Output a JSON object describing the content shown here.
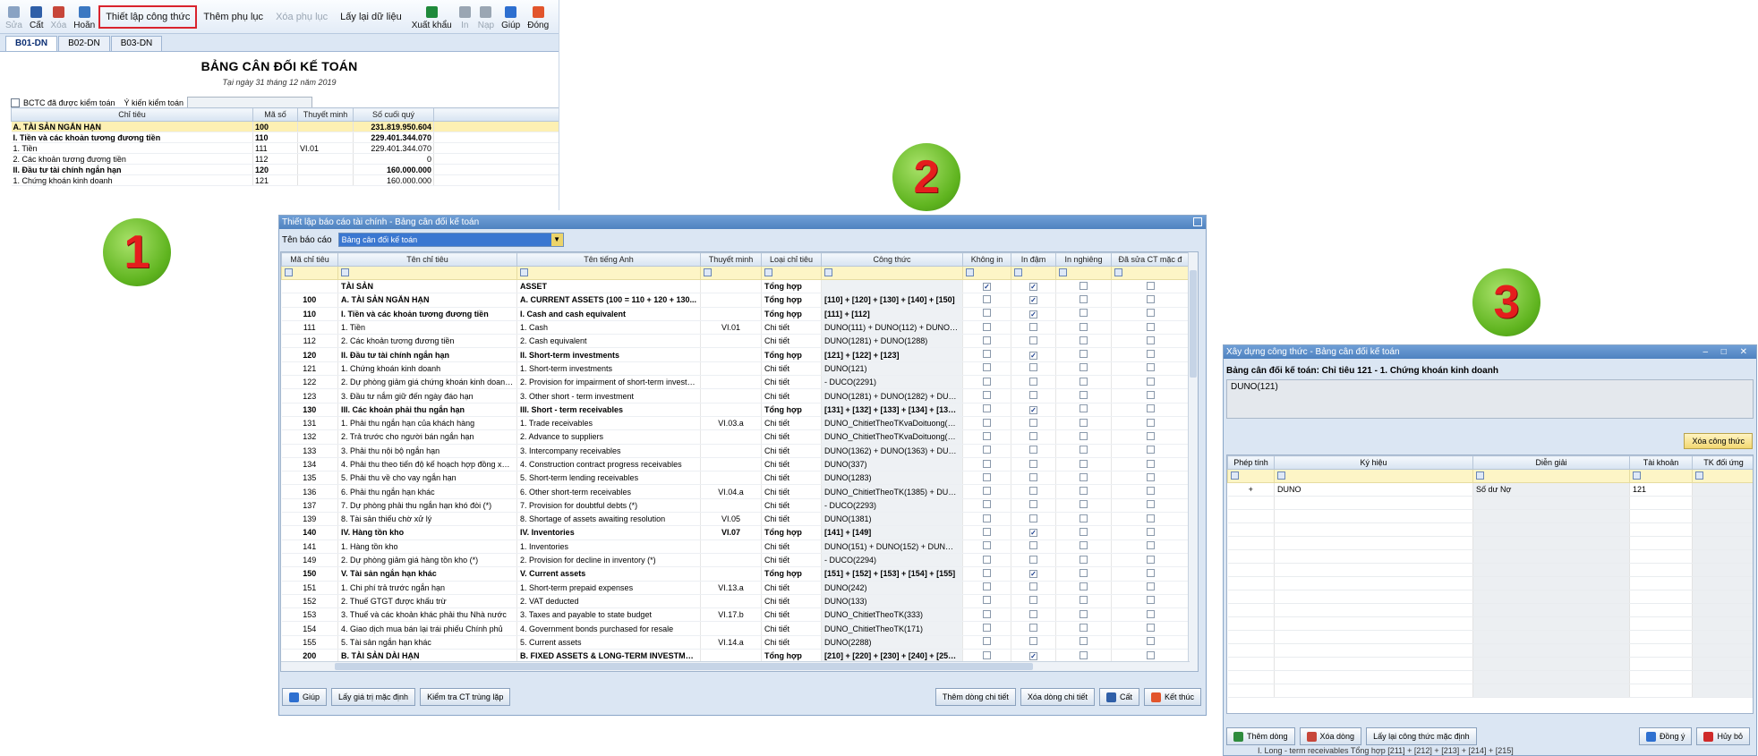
{
  "panel1": {
    "toolbar": [
      {
        "label": "Sửa",
        "icon": "edit-icon",
        "disabled": true
      },
      {
        "label": "Cất",
        "icon": "save-icon",
        "disabled": false
      },
      {
        "label": "Xóa",
        "icon": "delete-icon",
        "disabled": true
      },
      {
        "label": "Hoãn",
        "icon": "undo-icon",
        "disabled": false
      },
      {
        "label": "Thiết lập công thức",
        "text": true,
        "highlight": true
      },
      {
        "label": "Thêm phụ lục",
        "text": true
      },
      {
        "label": "Xóa phụ lục",
        "text": true,
        "disabled": true
      },
      {
        "label": "Lấy lại dữ liệu",
        "text": true
      },
      {
        "label": "Xuất khẩu",
        "icon": "excel-icon",
        "disabled": false
      },
      {
        "label": "In",
        "icon": "print-icon",
        "disabled": true
      },
      {
        "label": "Nạp",
        "icon": "load-icon",
        "disabled": true
      },
      {
        "label": "Giúp",
        "icon": "help-icon",
        "disabled": false
      },
      {
        "label": "Đóng",
        "icon": "close-icon",
        "disabled": false
      }
    ],
    "tabs": [
      "B01-DN",
      "B02-DN",
      "B03-DN"
    ],
    "report_title": "BẢNG CÂN ĐỐI KẾ TOÁN",
    "report_date": "Tại ngày 31 tháng 12 năm 2019",
    "audited_label": "BCTC đã được kiểm toán",
    "audit_opinion_label": "Ý kiến kiểm toán",
    "columns": [
      "Chỉ tiêu",
      "Mã số",
      "Thuyết minh",
      "Số cuối quý"
    ],
    "rows": [
      {
        "name": "A. TÀI SẢN NGẮN HẠN",
        "code": "100",
        "note": "",
        "value": "231.819.950.604",
        "bold": true,
        "hl": true
      },
      {
        "name": "I. Tiền và các khoản tương đương tiền",
        "code": "110",
        "note": "",
        "value": "229.401.344.070",
        "bold": true
      },
      {
        "name": "1. Tiền",
        "code": "111",
        "note": "VI.01",
        "value": "229.401.344.070"
      },
      {
        "name": "2. Các khoản tương đương tiền",
        "code": "112",
        "note": "",
        "value": "0"
      },
      {
        "name": "II. Đầu tư tài chính ngắn hạn",
        "code": "120",
        "note": "",
        "value": "160.000.000",
        "bold": true
      },
      {
        "name": "1. Chứng khoán kinh doanh",
        "code": "121",
        "note": "",
        "value": "160.000.000"
      }
    ]
  },
  "badges": [
    "1",
    "2",
    "3"
  ],
  "panel2": {
    "title": "Thiết lập báo cáo tài chính - Bảng cân đối kế toán",
    "report_label": "Tên báo cáo",
    "report_value": "Bảng cân đối kế toán",
    "columns": [
      "Mã chỉ tiêu",
      "Tên chỉ tiêu",
      "Tên tiếng Anh",
      "Thuyết minh",
      "Loại chỉ tiêu",
      "Công thức",
      "Không in",
      "In đậm",
      "In nghiêng",
      "Đã sửa CT mặc đ"
    ],
    "rows": [
      {
        "code": "",
        "name": "TÀI SẢN",
        "en": "ASSET",
        "note": "",
        "type": "Tổng hợp",
        "formula": "",
        "noprint": true,
        "bold": true,
        "b": true
      },
      {
        "code": "100",
        "name": "A. TÀI SẢN NGẮN HẠN",
        "en": "A. CURRENT ASSETS (100 = 110 + 120 + 130...",
        "note": "",
        "type": "Tổng hợp",
        "formula": "[110] + [120] + [130] + [140] + [150]",
        "bold": true,
        "b": true
      },
      {
        "code": "110",
        "name": "I. Tiền và các khoản tương đương tiền",
        "en": "I. Cash and cash equivalent",
        "note": "",
        "type": "Tổng hợp",
        "formula": "[111] + [112]",
        "bold": true,
        "b": true
      },
      {
        "code": "111",
        "name": "1. Tiền",
        "en": "1. Cash",
        "note": "VI.01",
        "type": "Chi tiết",
        "formula": "DUNO(111) + DUNO(112) + DUNO(1..."
      },
      {
        "code": "112",
        "name": "2. Các khoản tương đương tiền",
        "en": "2. Cash equivalent",
        "note": "",
        "type": "Chi tiết",
        "formula": "DUNO(1281) + DUNO(1288)"
      },
      {
        "code": "120",
        "name": "II. Đầu tư tài chính ngắn hạn",
        "en": "II. Short-term investments",
        "note": "",
        "type": "Tổng hợp",
        "formula": "[121] + [122] + [123]",
        "bold": true,
        "b": true
      },
      {
        "code": "121",
        "name": "1. Chứng khoán kinh doanh",
        "en": "1. Short-term investments",
        "note": "",
        "type": "Chi tiết",
        "formula": "DUNO(121)"
      },
      {
        "code": "122",
        "name": "2. Dự phòng giảm giá chứng khoán kinh doanh (...",
        "en": "2. Provision for impairment of short-term investm...",
        "note": "",
        "type": "Chi tiết",
        "formula": " - DUCO(2291)"
      },
      {
        "code": "123",
        "name": "3. Đầu tư nắm giữ đến ngày đáo hạn",
        "en": "3. Other short - term investment",
        "note": "",
        "type": "Chi tiết",
        "formula": "DUNO(1281) + DUNO(1282) + DUNO..."
      },
      {
        "code": "130",
        "name": "III. Các khoản phải thu ngắn hạn",
        "en": "III. Short - term receivables",
        "note": "",
        "type": "Tổng hợp",
        "formula": "[131] + [132] + [133] + [134] + [135]...",
        "bold": true,
        "b": true
      },
      {
        "code": "131",
        "name": "1. Phải thu ngắn hạn của khách hàng",
        "en": "1. Trade receivables",
        "note": "VI.03.a",
        "type": "Chi tiết",
        "formula": "DUNO_ChitietTheoTKvaDoituong(131)"
      },
      {
        "code": "132",
        "name": "2. Trả trước cho người bán ngắn hạn",
        "en": "2. Advance to suppliers",
        "note": "",
        "type": "Chi tiết",
        "formula": "DUNO_ChitietTheoTKvaDoituong(331)"
      },
      {
        "code": "133",
        "name": "3. Phải thu nội bộ ngắn hạn",
        "en": "3. Intercompany receivables",
        "note": "",
        "type": "Chi tiết",
        "formula": "DUNO(1362) + DUNO(1363) + DUNO..."
      },
      {
        "code": "134",
        "name": "4. Phải thu theo tiến độ kế hoạch hợp đồng xây...",
        "en": "4. Construction contract progress receivables",
        "note": "",
        "type": "Chi tiết",
        "formula": "DUNO(337)"
      },
      {
        "code": "135",
        "name": "5. Phải thu về cho vay ngắn hạn",
        "en": "5. Short-term lending receivables",
        "note": "",
        "type": "Chi tiết",
        "formula": "DUNO(1283)"
      },
      {
        "code": "136",
        "name": "6. Phải thu ngắn hạn khác",
        "en": "6. Other short-term receivables",
        "note": "VI.04.a",
        "type": "Chi tiết",
        "formula": "DUNO_ChitietTheoTK(1385) + DUNO..."
      },
      {
        "code": "137",
        "name": "7. Dự phòng phải thu ngắn hạn khó đòi (*)",
        "en": "7. Provision for doubtful debts (*)",
        "note": "",
        "type": "Chi tiết",
        "formula": " - DUCO(2293)"
      },
      {
        "code": "139",
        "name": "8. Tài sản thiếu chờ xử lý",
        "en": "8. Shortage of assets awaiting resolution",
        "note": "VI.05",
        "type": "Chi tiết",
        "formula": "DUNO(1381)"
      },
      {
        "code": "140",
        "name": "IV. Hàng tồn kho",
        "en": "IV. Inventories",
        "note": "VI.07",
        "type": "Tổng hợp",
        "formula": "[141] + [149]",
        "bold": true,
        "b": true
      },
      {
        "code": "141",
        "name": "1. Hàng tồn kho",
        "en": "1. Inventories",
        "note": "",
        "type": "Chi tiết",
        "formula": "DUNO(151) + DUNO(152) + DUNO(1..."
      },
      {
        "code": "149",
        "name": "2. Dự phòng giảm giá hàng tồn kho (*)",
        "en": "2. Provision for decline in inventory (*)",
        "note": "",
        "type": "Chi tiết",
        "formula": " - DUCO(2294)"
      },
      {
        "code": "150",
        "name": "V. Tài sản ngắn hạn khác",
        "en": "V. Current assets",
        "note": "",
        "type": "Tổng hợp",
        "formula": "[151] + [152] + [153] + [154] + [155]",
        "bold": true,
        "b": true
      },
      {
        "code": "151",
        "name": "1. Chi phí trả trước ngắn hạn",
        "en": "1. Short-term prepaid expenses",
        "note": "VI.13.a",
        "type": "Chi tiết",
        "formula": "DUNO(242)"
      },
      {
        "code": "152",
        "name": "2. Thuế GTGT được khấu trừ",
        "en": "2. VAT deducted",
        "note": "",
        "type": "Chi tiết",
        "formula": "DUNO(133)"
      },
      {
        "code": "153",
        "name": "3. Thuế và các khoản khác phải thu Nhà nước",
        "en": "3. Taxes and payable to state budget",
        "note": "VI.17.b",
        "type": "Chi tiết",
        "formula": "DUNO_ChitietTheoTK(333)"
      },
      {
        "code": "154",
        "name": "4. Giao dịch mua bán lại trái phiếu Chính phủ",
        "en": "4. Government bonds purchased for resale",
        "note": "",
        "type": "Chi tiết",
        "formula": "DUNO_ChitietTheoTK(171)"
      },
      {
        "code": "155",
        "name": "5. Tài sản ngắn hạn khác",
        "en": "5. Current assets",
        "note": "VI.14.a",
        "type": "Chi tiết",
        "formula": "DUNO(2288)"
      },
      {
        "code": "200",
        "name": "B. TÀI SẢN DÀI HẠN",
        "en": "B. FIXED ASSETS & LONG-TERM INVESTME...",
        "note": "",
        "type": "Tổng hợp",
        "formula": "[210] + [220] + [230] + [240] + [250]...",
        "bold": true,
        "b": true
      },
      {
        "code": "210",
        "name": "I. Các khoản phải thu dài hạn",
        "en": "I. Long - term receivables",
        "note": "",
        "type": "Tổng hợp",
        "formula": "[211] + [212] + [213] + [214] + [215]",
        "bold": true,
        "b": true
      }
    ],
    "footer_left": [
      {
        "label": "Giúp",
        "icon": "help-icon"
      },
      {
        "label": "Lấy giá trị mặc định"
      },
      {
        "label": "Kiểm tra CT trùng lặp"
      }
    ],
    "footer_right": [
      {
        "label": "Thêm dòng chi tiết"
      },
      {
        "label": "Xóa dòng chi tiết"
      },
      {
        "label": "Cất",
        "icon": "save-icon"
      },
      {
        "label": "Kết thúc",
        "icon": "exit-icon"
      }
    ]
  },
  "panel3": {
    "title": "Xây dựng công thức - Bảng cân đối kế toán",
    "window_controls": "– □ ✕",
    "header": "Bảng cân đối kế toán: Chỉ tiêu 121 - 1. Chứng khoán kinh doanh",
    "formula": "DUNO(121)",
    "clear_label": "Xóa công thức",
    "columns": [
      "Phép tính",
      "Ký hiệu",
      "Diễn giải",
      "Tài khoản",
      "TK đối ứng"
    ],
    "rows": [
      {
        "op": "+",
        "symbol": "DUNO",
        "desc": "Số dư Nợ",
        "account": "121",
        "contra": ""
      }
    ],
    "footer_left": [
      {
        "label": "Thêm dòng",
        "icon": "add-icon"
      },
      {
        "label": "Xóa dòng",
        "icon": "delete-icon"
      },
      {
        "label": "Lấy lại công thức mặc định"
      }
    ],
    "footer_right": [
      {
        "label": "Đồng ý",
        "icon": "check-icon"
      },
      {
        "label": "Hủy bỏ",
        "icon": "cancel-icon"
      }
    ],
    "underlay_text": "I. Long - term receivables           Tổng hợp      [211] + [212] + [213] + [214] + [215]"
  }
}
